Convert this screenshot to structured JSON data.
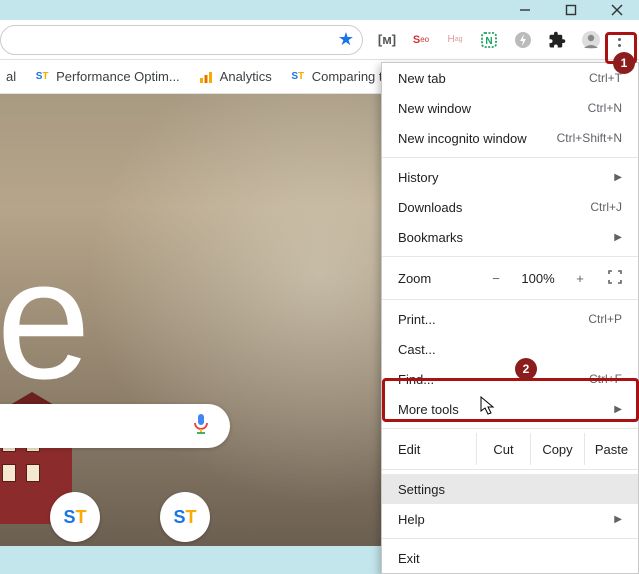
{
  "window_controls": {
    "minimize": "minimize",
    "maximize": "maximize",
    "close": "close"
  },
  "bookmarks": [
    {
      "label": "al",
      "icon": "",
      "icon_bg": "",
      "icon_fg": ""
    },
    {
      "label": "Performance Optim...",
      "icon": "ST",
      "icon_bg": "#fff",
      "icon_fg": ""
    },
    {
      "label": "Analytics",
      "icon": "ol",
      "icon_bg": "",
      "icon_fg": ""
    },
    {
      "label": "Comparing two",
      "icon": "ST",
      "icon_bg": "#fff",
      "icon_fg": ""
    }
  ],
  "ext_icons": [
    "markup-icon",
    "seo-icon",
    "htag-icon",
    "note-icon",
    "bolt-icon",
    "puzzle-icon",
    "profile-icon"
  ],
  "menu": {
    "group1": [
      {
        "label": "New tab",
        "shortcut": "Ctrl+T"
      },
      {
        "label": "New window",
        "shortcut": "Ctrl+N"
      },
      {
        "label": "New incognito window",
        "shortcut": "Ctrl+Shift+N"
      }
    ],
    "group2": [
      {
        "label": "History",
        "submenu": true
      },
      {
        "label": "Downloads",
        "shortcut": "Ctrl+J"
      },
      {
        "label": "Bookmarks",
        "submenu": true
      }
    ],
    "zoom": {
      "label": "Zoom",
      "minus": "−",
      "pct": "100%",
      "plus": "+"
    },
    "group3": [
      {
        "label": "Print...",
        "shortcut": "Ctrl+P"
      },
      {
        "label": "Cast..."
      },
      {
        "label": "Find...",
        "shortcut": "Ctrl+F"
      },
      {
        "label": "More tools",
        "submenu": true
      }
    ],
    "edit": {
      "label": "Edit",
      "cut": "Cut",
      "copy": "Copy",
      "paste": "Paste"
    },
    "group4": [
      {
        "label": "Settings",
        "highlight": true
      },
      {
        "label": "Help",
        "submenu": true
      }
    ],
    "exit": {
      "label": "Exit"
    }
  },
  "annotations": {
    "badge1": "1",
    "badge2": "2"
  },
  "logo_fragment": "gle"
}
